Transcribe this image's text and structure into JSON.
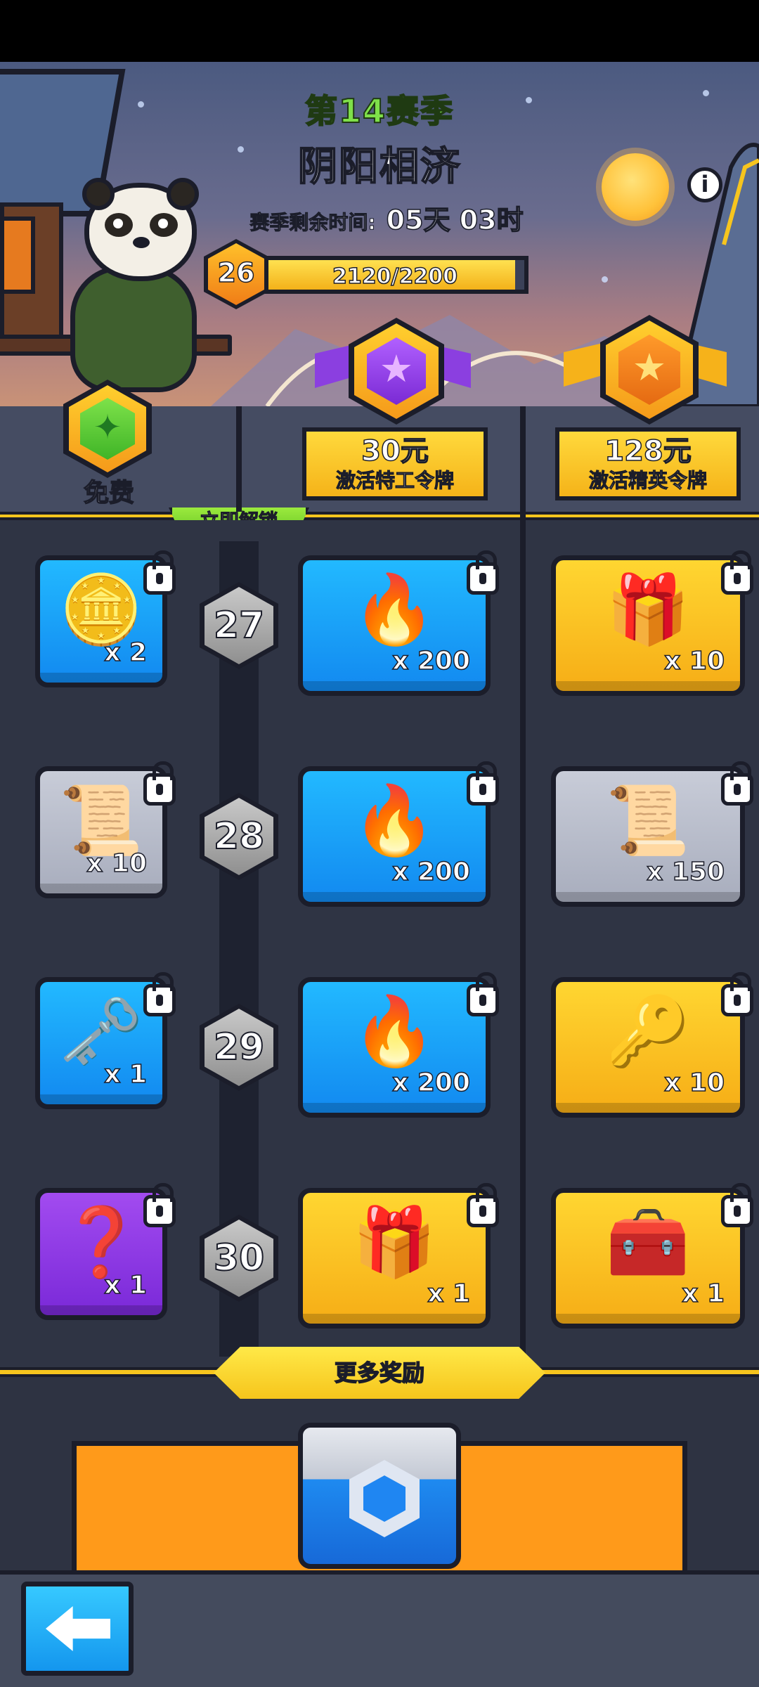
{
  "header": {
    "season_title": "第14赛季",
    "season_name": "阴阳相济",
    "timer_label": "赛季剩余时间:",
    "timer_value": "05天 03时",
    "player_level": "26",
    "xp_text": "2120/2200",
    "xp_progress": 0.964
  },
  "tiers": {
    "free_label": "免费",
    "special": {
      "price": "30元",
      "desc": "激活特工令牌"
    },
    "elite": {
      "price": "128元",
      "desc": "激活精英令牌"
    },
    "unlock_now": "立即解锁"
  },
  "rows": [
    {
      "level": "27",
      "free": {
        "icon": "gold-coin-speed-icon",
        "qty": "x 2",
        "style": "blue"
      },
      "special": {
        "icon": "fire-essence-icon",
        "qty": "x 200",
        "style": "blue"
      },
      "elite": {
        "icon": "purple-chest-icon",
        "qty": "x 10",
        "style": "yellow"
      }
    },
    {
      "level": "28",
      "free": {
        "icon": "mystery-scroll-icon",
        "qty": "x 10",
        "style": "gray"
      },
      "special": {
        "icon": "fire-essence-icon",
        "qty": "x 200",
        "style": "blue"
      },
      "elite": {
        "icon": "mystery-scroll-icon",
        "qty": "x 150",
        "style": "gray"
      }
    },
    {
      "level": "29",
      "free": {
        "icon": "silver-key-icon",
        "qty": "x 1",
        "style": "blue"
      },
      "special": {
        "icon": "fire-essence-icon",
        "qty": "x 200",
        "style": "blue"
      },
      "elite": {
        "icon": "crystal-key-icon",
        "qty": "x 10",
        "style": "yellow"
      }
    },
    {
      "level": "30",
      "free": {
        "icon": "mystery-chest-icon",
        "qty": "x 1",
        "style": "purple"
      },
      "special": {
        "icon": "purple-chest-icon",
        "qty": "x 1",
        "style": "yellow"
      },
      "elite": {
        "icon": "gold-chest-icon",
        "qty": "x 1",
        "style": "yellow"
      }
    }
  ],
  "more_rewards": "更多奖励",
  "colors": {
    "accent_yellow": "#f7c51e",
    "outline": "#1b1d2a",
    "tile_blue": "#1a9ef5",
    "tile_yellow": "#f9c023"
  }
}
